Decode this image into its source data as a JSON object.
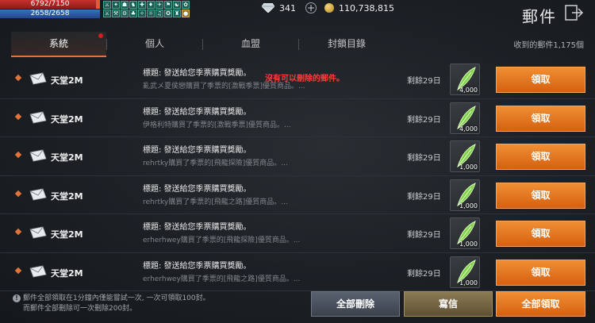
{
  "status": {
    "hp": "6792/7150",
    "mp": "2658/2658",
    "buffs": [
      "⚔",
      "✦",
      "☗",
      "♞",
      "✚",
      "♦",
      "✈",
      "⚑",
      "☯",
      "✿",
      "⚔",
      "⚒",
      "⚙",
      "♣",
      "✧",
      "☼",
      "♫",
      "✪",
      "♜",
      "●"
    ],
    "diamonds": "341",
    "gold": "110,738,815"
  },
  "header": {
    "title": "郵件"
  },
  "tabs": [
    {
      "label": "系統",
      "active": true,
      "badge": true
    },
    {
      "label": "個人",
      "active": false
    },
    {
      "label": "血盟",
      "active": false
    },
    {
      "label": "封鎖目錄",
      "active": false
    }
  ],
  "mail_count": "收到的郵件1,175個",
  "warning": "沒有可以刪除的郵件。",
  "mails": [
    {
      "sender": "天堂2M",
      "subject": "標題: 發送給您季票購買獎勵。",
      "body": "亂武メ夏侯戀購買了季票的[激戰季票]優質商品。...",
      "remain": "剩餘29日",
      "qty": "4,000",
      "claim": "領取"
    },
    {
      "sender": "天堂2M",
      "subject": "標題: 發送給您季票購買獎勵。",
      "body": "伊格利特購買了季票的[激戰季票]優質商品。...",
      "remain": "剩餘29日",
      "qty": "4,000",
      "claim": "領取"
    },
    {
      "sender": "天堂2M",
      "subject": "標題: 發送給您季票購買獎勵。",
      "body": "rehrtky購買了季票的[飛龍探險]優質商品。...",
      "remain": "剩餘29日",
      "qty": "1,000",
      "claim": "領取"
    },
    {
      "sender": "天堂2M",
      "subject": "標題: 發送給您季票購買獎勵。",
      "body": "rehrtky購買了季票的[飛龍之路]優質商品。...",
      "remain": "剩餘29日",
      "qty": "1,000",
      "claim": "領取"
    },
    {
      "sender": "天堂2M",
      "subject": "標題: 發送給您季票購買獎勵。",
      "body": "erherhwey購買了季票的[飛龍探險]優質商品。...",
      "remain": "剩餘29日",
      "qty": "1,000",
      "claim": "領取"
    },
    {
      "sender": "天堂2M",
      "subject": "標題: 發送給您季票購買獎勵。",
      "body": "erherhwey購買了季票的[飛龍之路]優質商品。...",
      "remain": "剩餘29日",
      "qty": "1,000",
      "claim": "領取"
    }
  ],
  "footer": {
    "note_line1": "郵件全部領取在1分鐘內僅能嘗試一次, 一次可領取100封。",
    "note_line2": "而郵件全部刪除可一次刪除200封。",
    "delete_all": "全部刪除",
    "write": "寫信",
    "claim_all": "全部領取"
  },
  "colors": {
    "accent": "#e0733a",
    "claim_button": "#e5781f",
    "warning": "#ff3b3b"
  }
}
